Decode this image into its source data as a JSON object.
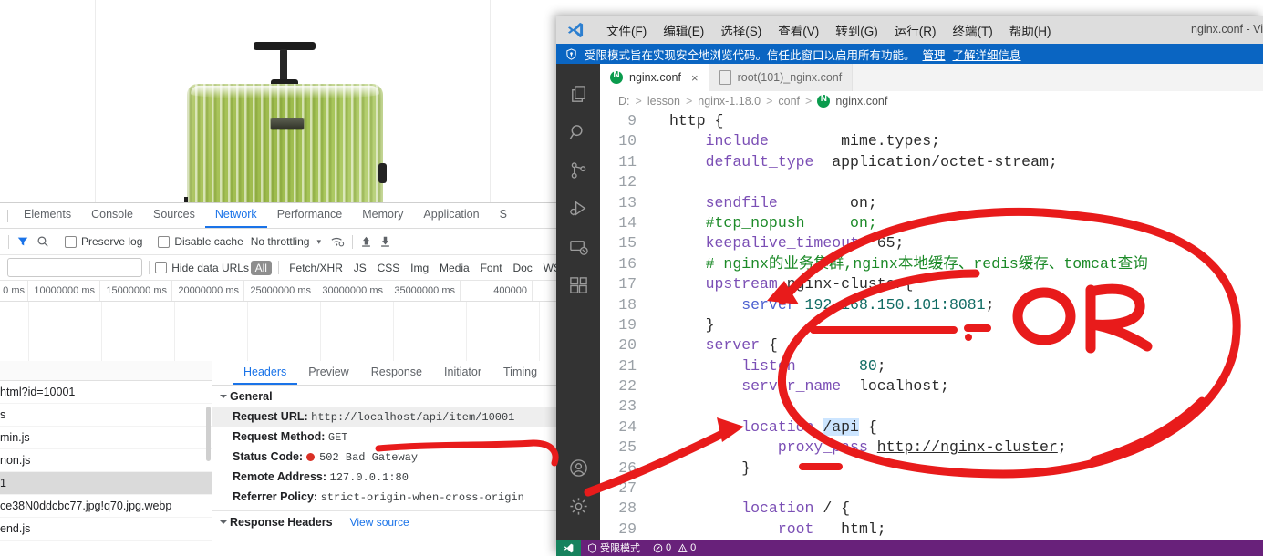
{
  "browser": {
    "product_image": {
      "alt": "green-suitcase-product-photo"
    },
    "devtools": {
      "panel_tabs": [
        {
          "label": "Elements",
          "active": false
        },
        {
          "label": "Console",
          "active": false
        },
        {
          "label": "Sources",
          "active": false
        },
        {
          "label": "Network",
          "active": true
        },
        {
          "label": "Performance",
          "active": false
        },
        {
          "label": "Memory",
          "active": false
        },
        {
          "label": "Application",
          "active": false
        },
        {
          "label": "S",
          "active": false
        }
      ],
      "toolbar": {
        "filter_icon": "funnel-icon",
        "search_icon": "search-icon",
        "preserve_log_label": "Preserve log",
        "preserve_log_checked": false,
        "disable_cache_label": "Disable cache",
        "disable_cache_checked": false,
        "throttling_value": "No throttling",
        "throttling_caret": "▾",
        "wifi_icon": "network-conditions-icon",
        "import_icon": "upload-har-icon",
        "export_icon": "download-har-icon"
      },
      "filter_row": {
        "filter_placeholder": "",
        "filter_value": "",
        "hide_data_urls_label": "Hide data URLs",
        "hide_data_urls_checked": false,
        "types": [
          {
            "label": "All",
            "selected": true
          },
          {
            "label": "Fetch/XHR",
            "selected": false
          },
          {
            "label": "JS",
            "selected": false
          },
          {
            "label": "CSS",
            "selected": false
          },
          {
            "label": "Img",
            "selected": false
          },
          {
            "label": "Media",
            "selected": false
          },
          {
            "label": "Font",
            "selected": false
          },
          {
            "label": "Doc",
            "selected": false
          },
          {
            "label": "WS",
            "selected": false
          }
        ]
      },
      "timeline_ticks": [
        "0 ms",
        "10000000 ms",
        "15000000 ms",
        "20000000 ms",
        "25000000 ms",
        "30000000 ms",
        "35000000 ms",
        "400000"
      ],
      "request_rows": [
        {
          "name": "html?id=10001",
          "selected": false
        },
        {
          "name": "s",
          "selected": false
        },
        {
          "name": "min.js",
          "selected": false
        },
        {
          "name": "non.js",
          "selected": false
        },
        {
          "name": "1",
          "selected": true
        },
        {
          "name": "ce38N0ddcbc77.jpg!q70.jpg.webp",
          "selected": false
        },
        {
          "name": "end.js",
          "selected": false
        }
      ],
      "detail": {
        "close_icon": "close-icon",
        "tabs": [
          {
            "label": "Headers",
            "active": true
          },
          {
            "label": "Preview",
            "active": false
          },
          {
            "label": "Response",
            "active": false
          },
          {
            "label": "Initiator",
            "active": false
          },
          {
            "label": "Timing",
            "active": false
          }
        ],
        "general_section_title": "General",
        "general_rows": [
          {
            "key": "Request URL:",
            "value": "http://localhost/api/item/10001",
            "highlighted": true
          },
          {
            "key": "Request Method:",
            "value": "GET",
            "highlighted": false
          },
          {
            "key": "Status Code:",
            "value": "502 Bad Gateway",
            "status_dot": "#d93025",
            "highlighted": false
          },
          {
            "key": "Remote Address:",
            "value": "127.0.0.1:80",
            "highlighted": false
          },
          {
            "key": "Referrer Policy:",
            "value": "strict-origin-when-cross-origin",
            "highlighted": false
          }
        ],
        "response_section_title": "Response Headers",
        "view_source_label": "View source"
      }
    }
  },
  "vscode": {
    "titlebar": {
      "logo": "vscode-logo-icon",
      "window_title": "nginx.conf - Vi",
      "menus": [
        {
          "label": "文件(F)",
          "mnemonic": "F"
        },
        {
          "label": "编辑(E)",
          "mnemonic": "E"
        },
        {
          "label": "选择(S)",
          "mnemonic": "S"
        },
        {
          "label": "查看(V)",
          "mnemonic": "V"
        },
        {
          "label": "转到(G)",
          "mnemonic": "G"
        },
        {
          "label": "运行(R)",
          "mnemonic": "R"
        },
        {
          "label": "终端(T)",
          "mnemonic": "T"
        },
        {
          "label": "帮助(H)",
          "mnemonic": "H"
        }
      ]
    },
    "trust_banner": {
      "icon": "shield-icon",
      "message": "受限模式旨在实现安全地浏览代码。信任此窗口以启用所有功能。",
      "manage_link": "管理",
      "learn_more_link": "了解详细信息",
      "background": "#0a65c2"
    },
    "activity_bar": [
      {
        "name": "explorer-icon",
        "title": "资源管理器"
      },
      {
        "name": "search-icon",
        "title": "搜索"
      },
      {
        "name": "source-control-icon",
        "title": "源代码管理"
      },
      {
        "name": "run-and-debug-icon",
        "title": "运行和调试"
      },
      {
        "name": "remote-explorer-icon",
        "title": "远程资源管理器"
      },
      {
        "name": "extensions-icon",
        "title": "扩展"
      },
      {
        "name": "accounts-icon",
        "title": "帐户"
      },
      {
        "name": "settings-gear-icon",
        "title": "管理"
      }
    ],
    "tabs": [
      {
        "label": "nginx.conf",
        "icon": "nginx-file-icon",
        "active": true,
        "close_icon": "×"
      },
      {
        "label": "root(101)_nginx.conf",
        "icon": "generic-file-icon",
        "active": false
      }
    ],
    "breadcrumb": [
      "D:",
      "lesson",
      "nginx-1.18.0",
      "conf",
      "nginx.conf"
    ],
    "editor": {
      "first_line_number": 9,
      "lines": [
        {
          "n": 9,
          "tokens": [
            {
              "t": "http {",
              "c": "plain"
            }
          ]
        },
        {
          "n": 10,
          "tokens": [
            {
              "t": "    ",
              "c": "plain"
            },
            {
              "t": "include",
              "c": "kw"
            },
            {
              "t": "        ",
              "c": "plain"
            },
            {
              "t": "mime.types;",
              "c": "plain"
            }
          ]
        },
        {
          "n": 11,
          "tokens": [
            {
              "t": "    ",
              "c": "plain"
            },
            {
              "t": "default_type",
              "c": "kw"
            },
            {
              "t": "  ",
              "c": "plain"
            },
            {
              "t": "application/octet-stream;",
              "c": "plain"
            }
          ]
        },
        {
          "n": 12,
          "tokens": []
        },
        {
          "n": 13,
          "tokens": [
            {
              "t": "    ",
              "c": "plain"
            },
            {
              "t": "sendfile",
              "c": "kw"
            },
            {
              "t": "        ",
              "c": "plain"
            },
            {
              "t": "on;",
              "c": "plain"
            }
          ]
        },
        {
          "n": 14,
          "tokens": [
            {
              "t": "    ",
              "c": "plain"
            },
            {
              "t": "#tcp_nopush",
              "c": "cmt"
            },
            {
              "t": "     ",
              "c": "plain"
            },
            {
              "t": "on;",
              "c": "cmt"
            }
          ]
        },
        {
          "n": 15,
          "tokens": [
            {
              "t": "    ",
              "c": "plain"
            },
            {
              "t": "keepalive_timeout",
              "c": "kw"
            },
            {
              "t": "  ",
              "c": "plain"
            },
            {
              "t": "65;",
              "c": "plain"
            }
          ]
        },
        {
          "n": 16,
          "tokens": [
            {
              "t": "    ",
              "c": "plain"
            },
            {
              "t": "# nginx的业务集群,nginx本地缓存、redis缓存、tomcat查询",
              "c": "cmt"
            }
          ]
        },
        {
          "n": 17,
          "tokens": [
            {
              "t": "    ",
              "c": "plain"
            },
            {
              "t": "upstream",
              "c": "kw"
            },
            {
              "t": " nginx-cluster{",
              "c": "plain"
            }
          ]
        },
        {
          "n": 18,
          "tokens": [
            {
              "t": "        ",
              "c": "plain"
            },
            {
              "t": "server",
              "c": "kw2"
            },
            {
              "t": " ",
              "c": "plain"
            },
            {
              "t": "192.168.150.101:8081",
              "c": "str"
            },
            {
              "t": ";",
              "c": "plain"
            }
          ]
        },
        {
          "n": 19,
          "tokens": [
            {
              "t": "    }",
              "c": "plain"
            }
          ]
        },
        {
          "n": 20,
          "tokens": [
            {
              "t": "    ",
              "c": "plain"
            },
            {
              "t": "server",
              "c": "kw"
            },
            {
              "t": " {",
              "c": "plain"
            }
          ]
        },
        {
          "n": 21,
          "tokens": [
            {
              "t": "        ",
              "c": "plain"
            },
            {
              "t": "listen",
              "c": "kw"
            },
            {
              "t": "       ",
              "c": "plain"
            },
            {
              "t": "80",
              "c": "num"
            },
            {
              "t": ";",
              "c": "plain"
            }
          ]
        },
        {
          "n": 22,
          "tokens": [
            {
              "t": "        ",
              "c": "plain"
            },
            {
              "t": "server_name",
              "c": "kw"
            },
            {
              "t": "  localhost;",
              "c": "plain"
            }
          ]
        },
        {
          "n": 23,
          "tokens": []
        },
        {
          "n": 24,
          "tokens": [
            {
              "t": "        ",
              "c": "plain"
            },
            {
              "t": "location",
              "c": "kw"
            },
            {
              "t": " ",
              "c": "plain"
            },
            {
              "t": "/api",
              "c": "plain sel"
            },
            {
              "t": " {",
              "c": "plain"
            }
          ]
        },
        {
          "n": 25,
          "tokens": [
            {
              "t": "            ",
              "c": "plain"
            },
            {
              "t": "proxy_pass",
              "c": "kw"
            },
            {
              "t": " ",
              "c": "plain"
            },
            {
              "t": "http://nginx-cluster",
              "c": "plain uline"
            },
            {
              "t": ";",
              "c": "plain"
            }
          ]
        },
        {
          "n": 26,
          "tokens": [
            {
              "t": "        }",
              "c": "plain"
            }
          ]
        },
        {
          "n": 27,
          "tokens": []
        },
        {
          "n": 28,
          "tokens": [
            {
              "t": "        ",
              "c": "plain"
            },
            {
              "t": "location",
              "c": "kw"
            },
            {
              "t": " / {",
              "c": "plain"
            }
          ]
        },
        {
          "n": 29,
          "tokens": [
            {
              "t": "            ",
              "c": "plain"
            },
            {
              "t": "root",
              "c": "kw"
            },
            {
              "t": "   html;",
              "c": "plain"
            }
          ]
        }
      ],
      "selection_text": "/api"
    },
    "statusbar": {
      "remote_icon": "remote-indicator-icon",
      "restricted_mode_label": "受限模式",
      "restricted_mode_icon": "shield-icon",
      "error_count": "0",
      "warning_count": "0",
      "error_icon": "error-circle-icon",
      "warning_icon": "warning-triangle-icon",
      "background": "#68217a"
    }
  },
  "annotations": {
    "color": "#e81b1b",
    "items": [
      {
        "name": "or-text-annotation",
        "label": "OR"
      },
      {
        "name": "big-circle-annotation",
        "label": ""
      },
      {
        "name": "arrow-to-location-api",
        "label": ""
      },
      {
        "name": "arrow-to-upstream-server",
        "label": ""
      },
      {
        "name": "underline-server-ip",
        "label": ""
      },
      {
        "name": "underline-proxy-pass",
        "label": ""
      },
      {
        "name": "underline-request-url",
        "label": ""
      }
    ]
  }
}
